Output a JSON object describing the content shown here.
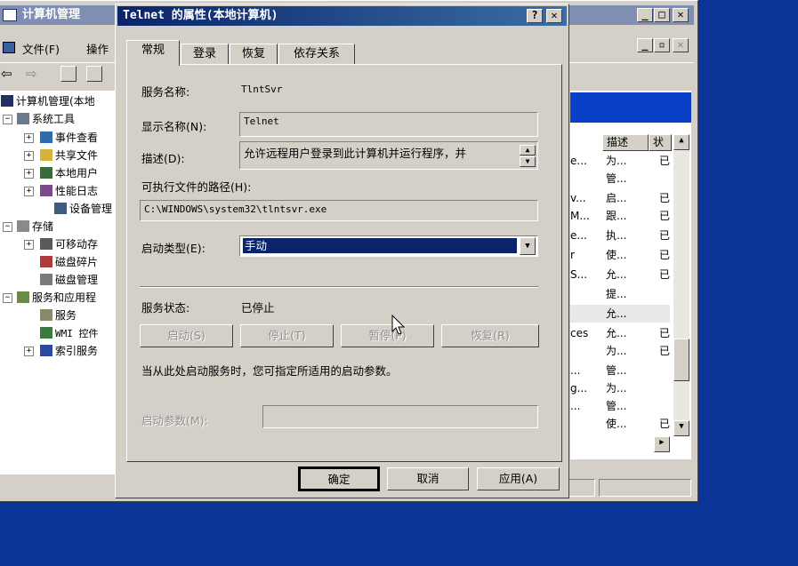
{
  "main_window": {
    "title": "计算机管理",
    "menu": {
      "file": "文件(F)",
      "action": "操作"
    },
    "toolbar": {
      "back": "⇦",
      "forward": "⇨"
    },
    "tree": [
      {
        "label": "计算机管理(本地",
        "icon": "computer-management-icon"
      },
      {
        "label": "系统工具",
        "icon": "system-tools-icon"
      },
      {
        "label": "事件查看",
        "icon": "event-viewer-icon"
      },
      {
        "label": "共享文件",
        "icon": "shared-folders-icon"
      },
      {
        "label": "本地用户",
        "icon": "local-users-icon"
      },
      {
        "label": "性能日志",
        "icon": "performance-logs-icon"
      },
      {
        "label": "设备管理",
        "icon": "device-manager-icon"
      },
      {
        "label": "存储",
        "icon": "storage-icon"
      },
      {
        "label": "可移动存",
        "icon": "removable-storage-icon"
      },
      {
        "label": "磁盘碎片",
        "icon": "disk-defrag-icon"
      },
      {
        "label": "磁盘管理",
        "icon": "disk-management-icon"
      },
      {
        "label": "服务和应用程",
        "icon": "services-apps-icon"
      },
      {
        "label": "服务",
        "icon": "services-icon"
      },
      {
        "label": "WMI 控件",
        "icon": "wmi-icon"
      },
      {
        "label": "索引服务",
        "icon": "indexing-icon"
      }
    ],
    "columns": {
      "description": "描述",
      "status": "状"
    },
    "rows": [
      {
        "prefix": "e...",
        "desc": "为...",
        "status": "已"
      },
      {
        "prefix": "",
        "desc": "管...",
        "status": ""
      },
      {
        "prefix": "v...",
        "desc": "启...",
        "status": "已"
      },
      {
        "prefix": "M...",
        "desc": "跟...",
        "status": "已"
      },
      {
        "prefix": "e...",
        "desc": "执...",
        "status": "已"
      },
      {
        "prefix": "r",
        "desc": "使...",
        "status": "已"
      },
      {
        "prefix": "S...",
        "desc": "允...",
        "status": "已"
      },
      {
        "prefix": "",
        "desc": "提...",
        "status": ""
      },
      {
        "prefix": "",
        "desc": "允...",
        "status": ""
      },
      {
        "prefix": "ces",
        "desc": "允...",
        "status": "已"
      },
      {
        "prefix": "",
        "desc": "为...",
        "status": "已"
      },
      {
        "prefix": "...",
        "desc": "管...",
        "status": ""
      },
      {
        "prefix": "g...",
        "desc": "为...",
        "status": ""
      },
      {
        "prefix": "...",
        "desc": "管...",
        "status": ""
      },
      {
        "prefix": "",
        "desc": "使...",
        "status": "已"
      }
    ]
  },
  "dialog": {
    "title": "Telnet 的属性(本地计算机)",
    "help_button": "?",
    "close_button": "✕",
    "tabs": [
      "常规",
      "登录",
      "恢复",
      "依存关系"
    ],
    "service_name_label": "服务名称:",
    "service_name_value": "TlntSvr",
    "display_name_label": "显示名称(N):",
    "display_name_value": "Telnet",
    "description_label": "描述(D):",
    "description_value": "允许远程用户登录到此计算机并运行程序，并",
    "exe_path_label": "可执行文件的路径(H):",
    "exe_path_value": "C:\\WINDOWS\\system32\\tlntsvr.exe",
    "startup_type_label": "启动类型(E):",
    "startup_type_value": "手动",
    "service_status_label": "服务状态:",
    "service_status_value": "已停止",
    "buttons": {
      "start": "启动(S)",
      "stop": "停止(T)",
      "pause": "暂停(P)",
      "resume": "恢复(R)"
    },
    "hint_text": "当从此处启动服务时，您可指定所适用的启动参数。",
    "start_params_label": "启动参数(M):",
    "start_params_value": "",
    "footer": {
      "ok": "确定",
      "cancel": "取消",
      "apply": "应用(A)"
    }
  }
}
